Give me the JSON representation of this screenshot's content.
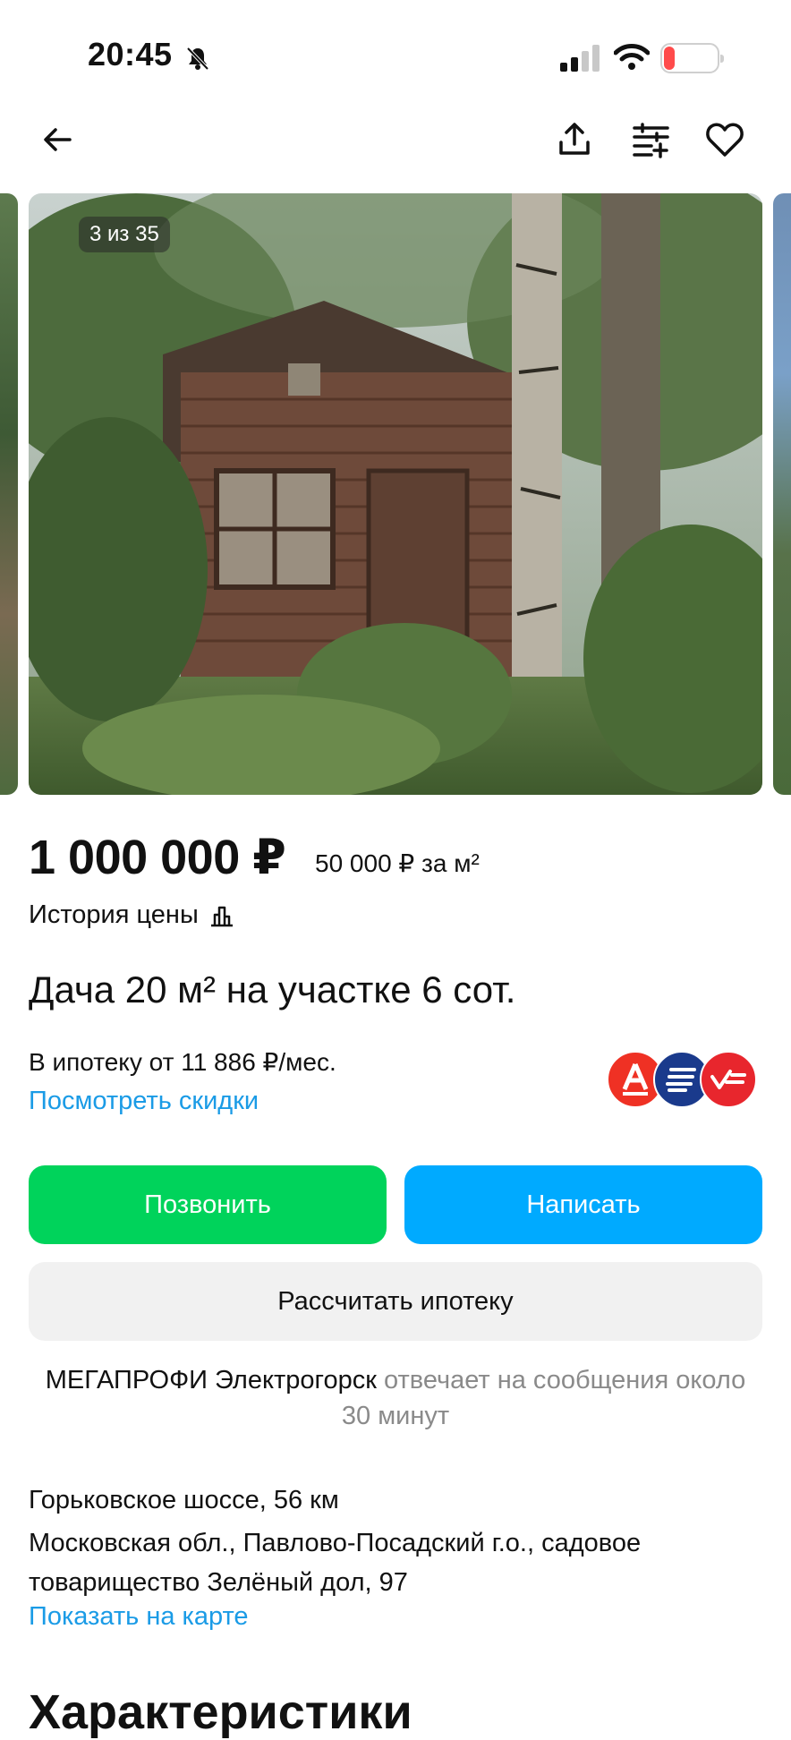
{
  "status_bar": {
    "time": "20:45",
    "battery": "15"
  },
  "gallery": {
    "counter": "3 из 35"
  },
  "listing": {
    "price": "1 000 000 ₽",
    "price_per_sqm": "50 000 ₽ за м²",
    "price_history_label": "История цены",
    "title": "Дача 20 м² на участке 6 сот."
  },
  "mortgage": {
    "text": "В ипотеку от 11 886 ₽/мес.",
    "discounts_link": "Посмотреть скидки",
    "bank_logos": [
      "alfa-bank-icon",
      "bank-stripes-icon",
      "bank-check-icon"
    ],
    "bank_colors": [
      "#ef3124",
      "#1a3a8c",
      "#e8262d"
    ]
  },
  "actions": {
    "call_label": "Позвонить",
    "write_label": "Написать",
    "calc_label": "Рассчитать ипотеку"
  },
  "seller": {
    "name": "МЕГАПРОФИ Электрогорск",
    "response_text": "отвечает на сообщения около 30 минут"
  },
  "location": {
    "highway": "Горьковское шоссе, 56 км",
    "address": "Московская обл., Павлово-Посадский г.о., садовое товарищество Зелёный дол, 97",
    "map_link": "Показать на карте"
  },
  "section_title": "Характеристики",
  "colors": {
    "green": "#00d35b",
    "blue": "#00aaff",
    "link": "#1a9be6"
  }
}
